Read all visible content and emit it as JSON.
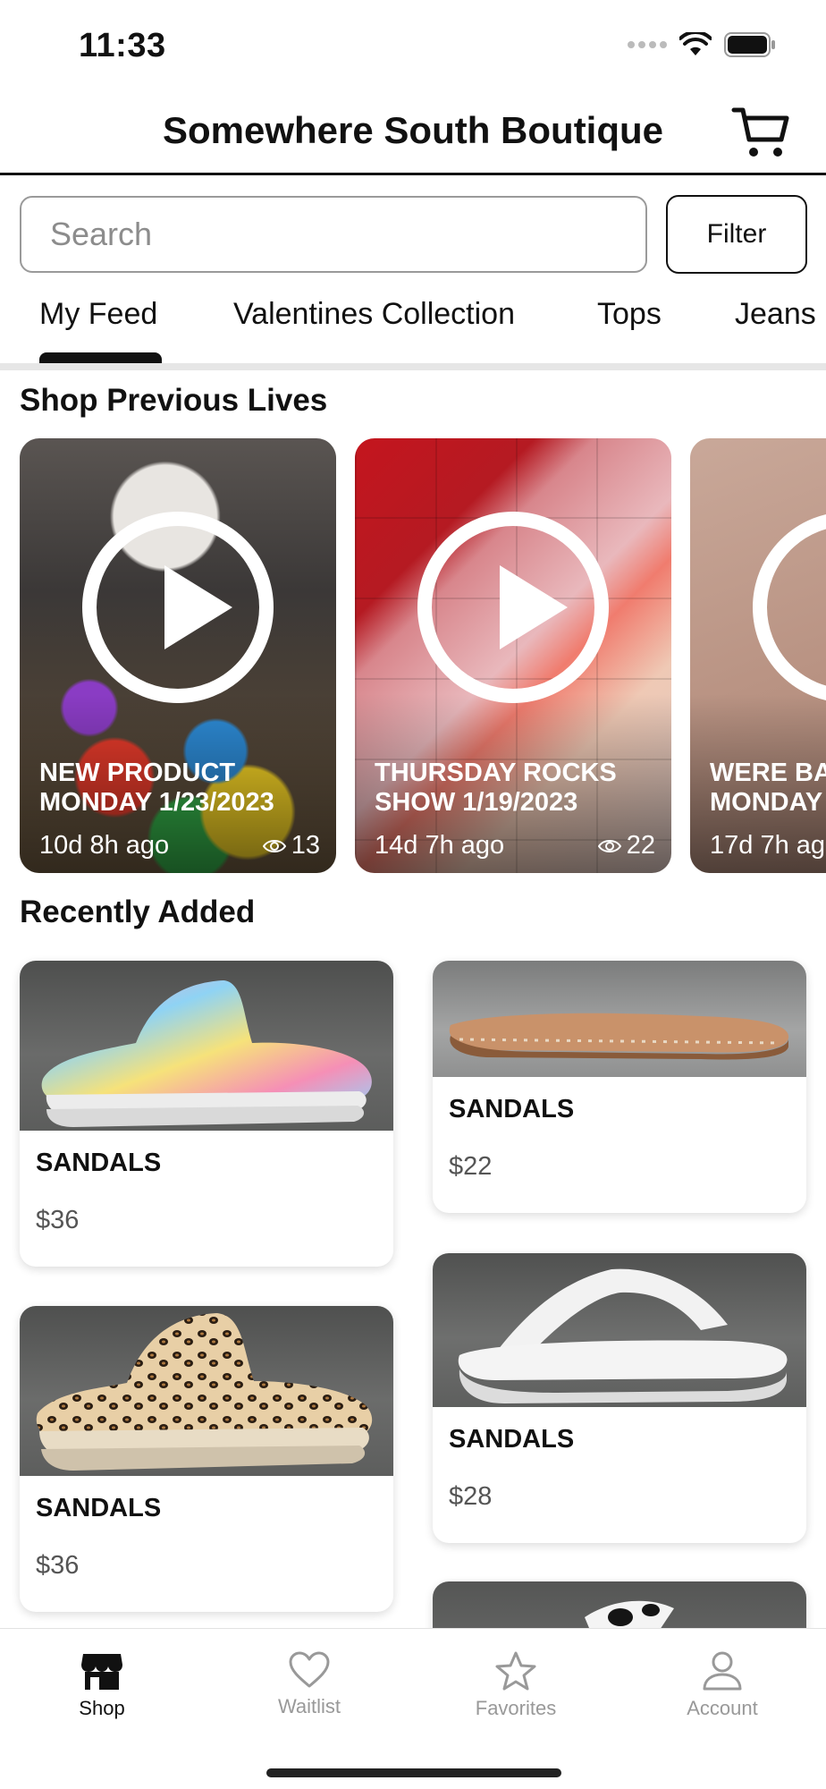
{
  "status_bar": {
    "time": "11:33"
  },
  "header": {
    "title": "Somewhere South Boutique",
    "cart_icon": "cart-icon"
  },
  "search": {
    "placeholder": "Search",
    "filter_label": "Filter"
  },
  "tabs": [
    {
      "label": "My Feed",
      "active": true
    },
    {
      "label": "Valentines Collection",
      "active": false
    },
    {
      "label": "Tops",
      "active": false
    },
    {
      "label": "Jeans",
      "active": false
    }
  ],
  "previous_lives": {
    "title": "Shop Previous Lives",
    "items": [
      {
        "title": "NEW PRODUCT MONDAY 1/23/2023",
        "ago": "10d 8h ago",
        "views": "13"
      },
      {
        "title": "THURSDAY ROCKS SHOW 1/19/2023",
        "ago": "14d 7h ago",
        "views": "22"
      },
      {
        "title": "WERE BA MONDAY",
        "ago": "17d 7h ag",
        "views": ""
      }
    ]
  },
  "recently_added": {
    "title": "Recently Added",
    "items": [
      {
        "name": "SANDALS",
        "price": "$36"
      },
      {
        "name": "SANDALS",
        "price": "$22"
      },
      {
        "name": "SANDALS",
        "price": "$36"
      },
      {
        "name": "SANDALS",
        "price": "$28"
      }
    ]
  },
  "bottom_nav": [
    {
      "label": "Shop",
      "icon": "store-icon",
      "active": true
    },
    {
      "label": "Waitlist",
      "icon": "heart-icon",
      "active": false
    },
    {
      "label": "Favorites",
      "icon": "star-icon",
      "active": false
    },
    {
      "label": "Account",
      "icon": "person-icon",
      "active": false
    }
  ],
  "colors": {
    "accent": "#111111",
    "inactive": "#999999",
    "tab_divider": "#e6e6e6"
  }
}
